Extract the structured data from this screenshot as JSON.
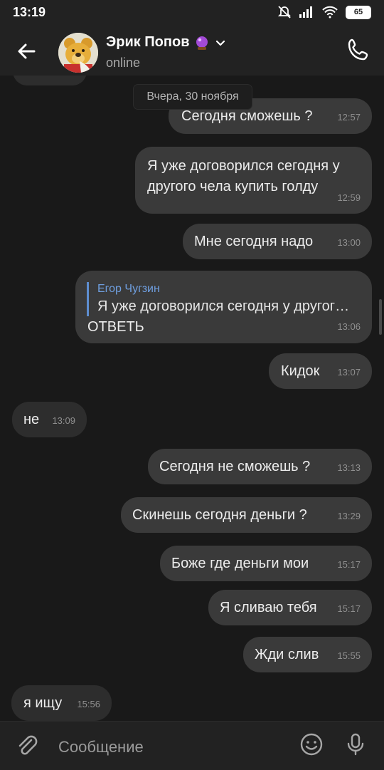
{
  "status_bar": {
    "time": "13:19",
    "battery": "65"
  },
  "header": {
    "contact_name": "Эрик Попов",
    "presence": "online"
  },
  "date_chip": "Вчера, 30 ноября",
  "composer": {
    "placeholder": "Сообщение"
  },
  "messages": [
    {
      "id": "m1",
      "direction": "out",
      "text": "Сегодня сможешь ?",
      "time": "12:57"
    },
    {
      "id": "m2",
      "direction": "out",
      "text_lines": [
        "Я уже договорился сегодня у",
        "другого чела купить голду"
      ],
      "time": "12:59"
    },
    {
      "id": "m3",
      "direction": "out",
      "text": "Мне сегодня надо",
      "time": "13:00"
    },
    {
      "id": "m4",
      "direction": "out",
      "reply_author": "Егор Чугзин",
      "reply_text": "Я уже договорился сегодня у другог…",
      "text": "ОТВЕТЬ",
      "time": "13:06"
    },
    {
      "id": "m5",
      "direction": "out",
      "text": "Кидок",
      "time": "13:07"
    },
    {
      "id": "m6",
      "direction": "in",
      "text": "не",
      "time": "13:09"
    },
    {
      "id": "m7",
      "direction": "out",
      "text": "Сегодня не сможешь ?",
      "time": "13:13"
    },
    {
      "id": "m8",
      "direction": "out",
      "text": "Скинешь сегодня деньги ?",
      "time": "13:29"
    },
    {
      "id": "m9",
      "direction": "out",
      "text": "Боже где деньги мои",
      "time": "15:17"
    },
    {
      "id": "m10",
      "direction": "out",
      "text": "Я сливаю тебя",
      "time": "15:17"
    },
    {
      "id": "m11",
      "direction": "out",
      "text": "Жди слив",
      "time": "15:55"
    },
    {
      "id": "m12",
      "direction": "in",
      "text": "я ищу",
      "time": "15:56"
    }
  ]
}
